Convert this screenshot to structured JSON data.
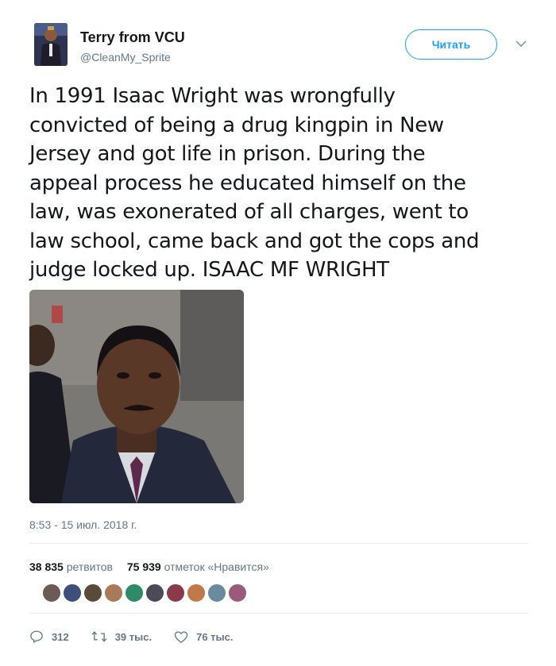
{
  "author": {
    "name": "Terry from VCU",
    "handle": "@CleanMy_Sprite",
    "follow_label": "Читать"
  },
  "tweet": {
    "lines": [
      "In 1991 Isaac Wright was wrongfully",
      "convicted of being a drug kingpin in New",
      "Jersey and got life in prison. During the",
      "appeal process he educated himself on the",
      "law, was exonerated of all charges, went to",
      "law school, came back and got the cops and",
      "judge locked up. ISAAC MF WRIGHT"
    ],
    "timestamp": "8:53 - 15 июл. 2018 г."
  },
  "stats": {
    "retweets_count": "38 835",
    "retweets_label": "ретвитов",
    "likes_count": "75 939",
    "likes_label": "отметок «Нравится»"
  },
  "likers": [
    {
      "color": "#6b5a55"
    },
    {
      "color": "#3d4f7a"
    },
    {
      "color": "#5a4a3a"
    },
    {
      "color": "#a87a5a"
    },
    {
      "color": "#2f8a6a"
    },
    {
      "color": "#4a4a5a"
    },
    {
      "color": "#8a3a4a"
    },
    {
      "color": "#c07a4a"
    },
    {
      "color": "#6a8aa0"
    },
    {
      "color": "#9a5a7a"
    }
  ],
  "actions": {
    "replies": "312",
    "retweets": "39 тыс.",
    "likes": "76 тыс."
  },
  "colors": {
    "accent": "#1da1f2",
    "secondary_text": "#657786",
    "primary_text": "#14171a",
    "divider": "#e6ecf0"
  },
  "icons": {
    "caret": "chevron-down-icon",
    "reply": "reply-icon",
    "retweet": "retweet-icon",
    "like": "heart-icon"
  }
}
